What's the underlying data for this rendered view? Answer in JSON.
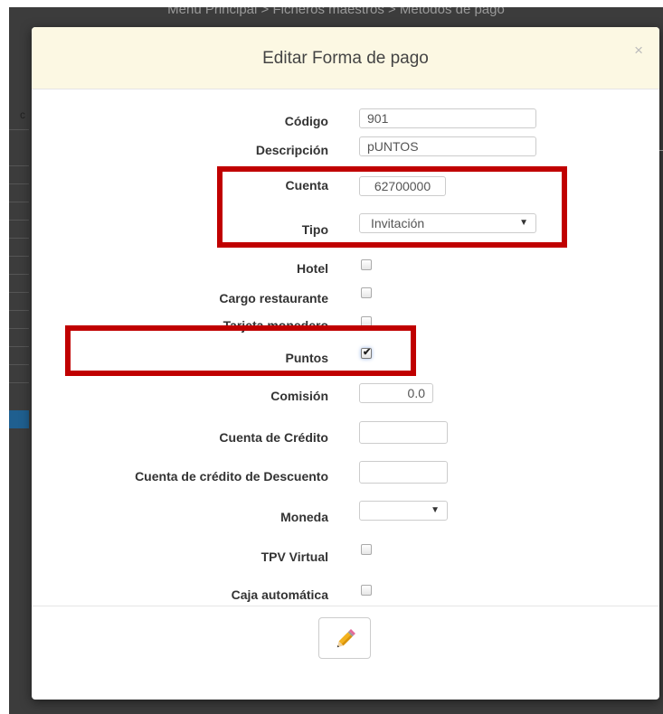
{
  "background": {
    "breadcrumb": "Menú Principal > Ficheros maestros > Métodos de pago",
    "left_letter": "c"
  },
  "modal": {
    "title": "Editar Forma de pago",
    "close": "×"
  },
  "form": {
    "codigo": {
      "label": "Código",
      "value": "901"
    },
    "descripcion": {
      "label": "Descripción",
      "value": "pUNTOS"
    },
    "cuenta": {
      "label": "Cuenta",
      "value": "62700000"
    },
    "tipo": {
      "label": "Tipo",
      "selected": "Invitación"
    },
    "hotel": {
      "label": "Hotel",
      "checked": false
    },
    "cargo_restaurante": {
      "label": "Cargo restaurante",
      "checked": false
    },
    "tarjeta_monedero": {
      "label": "Tarjeta monedero",
      "checked": false
    },
    "puntos": {
      "label": "Puntos",
      "checked": true
    },
    "comision": {
      "label": "Comisión",
      "value": "0.0"
    },
    "cuenta_credito": {
      "label": "Cuenta de Crédito",
      "value": ""
    },
    "cuenta_credito_descuento": {
      "label": "Cuenta de crédito de Descuento",
      "value": ""
    },
    "moneda": {
      "label": "Moneda",
      "selected": ""
    },
    "tpv_virtual": {
      "label": "TPV Virtual",
      "checked": false
    },
    "caja_automatica": {
      "label": "Caja automática",
      "checked": false
    }
  },
  "icons": {
    "edit": "pencil-icon",
    "close": "close-icon",
    "caret": "chevron-down-icon"
  },
  "colors": {
    "header_bg": "#fcf8e3",
    "highlight": "#c00000",
    "overlay": "#3c3c3c"
  }
}
